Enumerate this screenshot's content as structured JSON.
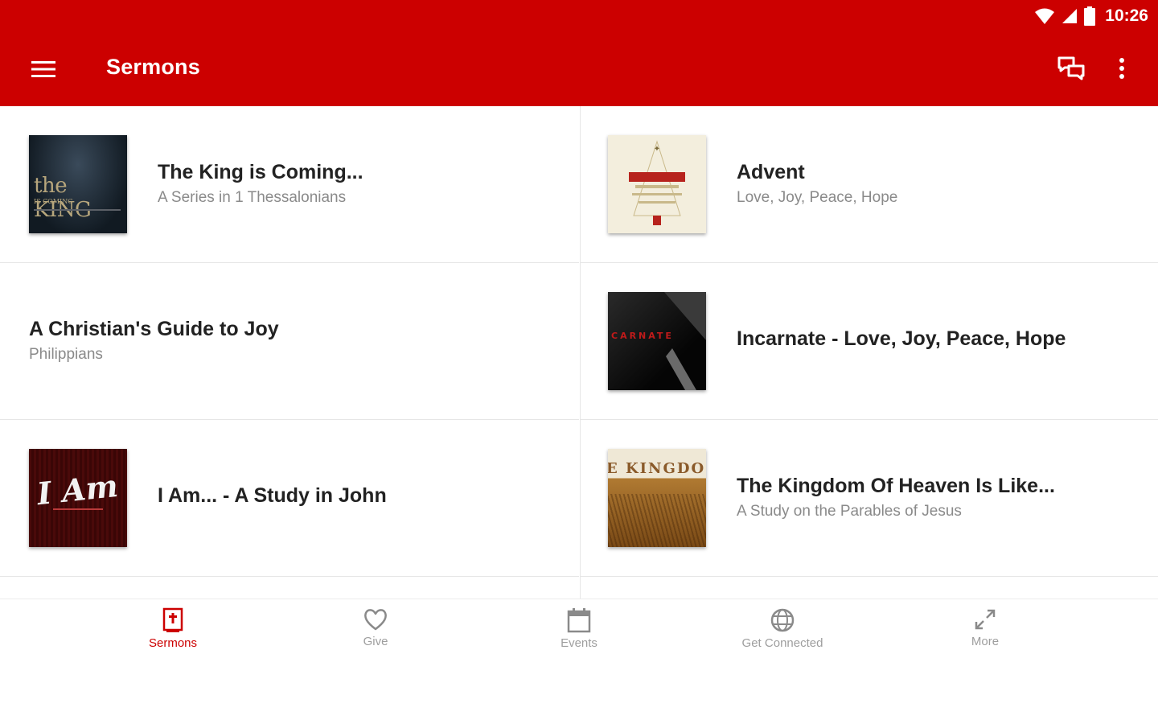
{
  "status_bar": {
    "time": "10:26"
  },
  "app_bar": {
    "title": "Sermons",
    "background": "#cc0000"
  },
  "sermons": [
    {
      "title": "The King is Coming...",
      "subtitle": "A Series in 1 Thessalonians",
      "art_text": "the KING",
      "art_subtext": "IS COMING"
    },
    {
      "title": "Advent",
      "subtitle": "Love, Joy, Peace, Hope",
      "art_text": ""
    },
    {
      "title": "A Christian's Guide to Joy",
      "subtitle": "Philippians"
    },
    {
      "title": "Incarnate - Love, Joy, Peace, Hope",
      "subtitle": "",
      "art_text": "CARNATE"
    },
    {
      "title": "I Am... - A Study in John",
      "subtitle": "",
      "art_text": "I Am"
    },
    {
      "title": "The Kingdom Of Heaven Is Like...",
      "subtitle": "A Study on the Parables of Jesus",
      "art_text": "E KINGDO"
    }
  ],
  "bottom_nav": [
    {
      "label": "Sermons",
      "icon": "bible-icon",
      "active": true
    },
    {
      "label": "Give",
      "icon": "heart-icon",
      "active": false
    },
    {
      "label": "Events",
      "icon": "calendar-icon",
      "active": false
    },
    {
      "label": "Get Connected",
      "icon": "globe-icon",
      "active": false
    },
    {
      "label": "More",
      "icon": "expand-arrows-icon",
      "active": false
    }
  ],
  "colors": {
    "accent": "#cc0000",
    "inactive": "#9e9e9e"
  }
}
